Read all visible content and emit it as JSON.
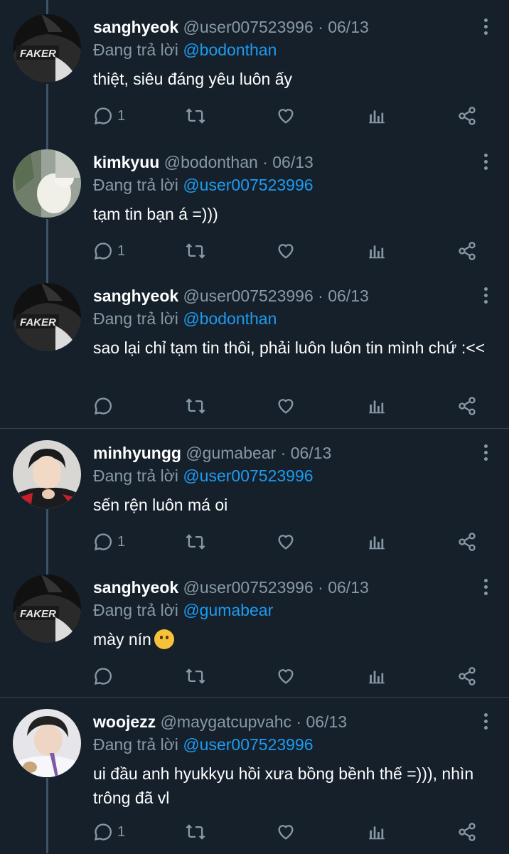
{
  "reply_prefix": "Đang trả lời",
  "tweets": [
    {
      "name": "sanghyeok",
      "handle": "@user007523996",
      "dot": "·",
      "date": "06/13",
      "reply_to": "@bodonthan",
      "text": "thiệt, siêu đáng yêu luôn ấy",
      "reply_count": "1",
      "avatar": "faker"
    },
    {
      "name": "kimkyuu",
      "handle": "@bodonthan",
      "dot": "·",
      "date": "06/13",
      "reply_to": "@user007523996",
      "text": "tạm tin bạn á =)))",
      "reply_count": "1",
      "avatar": "cat"
    },
    {
      "name": "sanghyeok",
      "handle": "@user007523996",
      "dot": "·",
      "date": "06/13",
      "reply_to": "@bodonthan",
      "text": "sao lại chỉ tạm tin thôi, phải luôn luôn tin mình chứ :<<",
      "reply_count": "",
      "avatar": "faker"
    },
    {
      "name": "minhyungg",
      "handle": "@gumabear",
      "dot": "·",
      "date": "06/13",
      "reply_to": "@user007523996",
      "text": "sến rện luôn má oi",
      "reply_count": "1",
      "avatar": "player"
    },
    {
      "name": "sanghyeok",
      "handle": "@user007523996",
      "dot": "·",
      "date": "06/13",
      "reply_to": "@gumabear",
      "text": "mày nín",
      "reply_count": "",
      "avatar": "faker",
      "emoji": "shushing-face"
    },
    {
      "name": "woojezz",
      "handle": "@maygatcupvahc",
      "dot": "·",
      "date": "06/13",
      "reply_to": "@user007523996",
      "text": "ui đầu anh hyukkyu hồi xưa bồng bềnh thế =))), nhìn trông đã vl",
      "reply_count": "1",
      "avatar": "photo"
    }
  ]
}
